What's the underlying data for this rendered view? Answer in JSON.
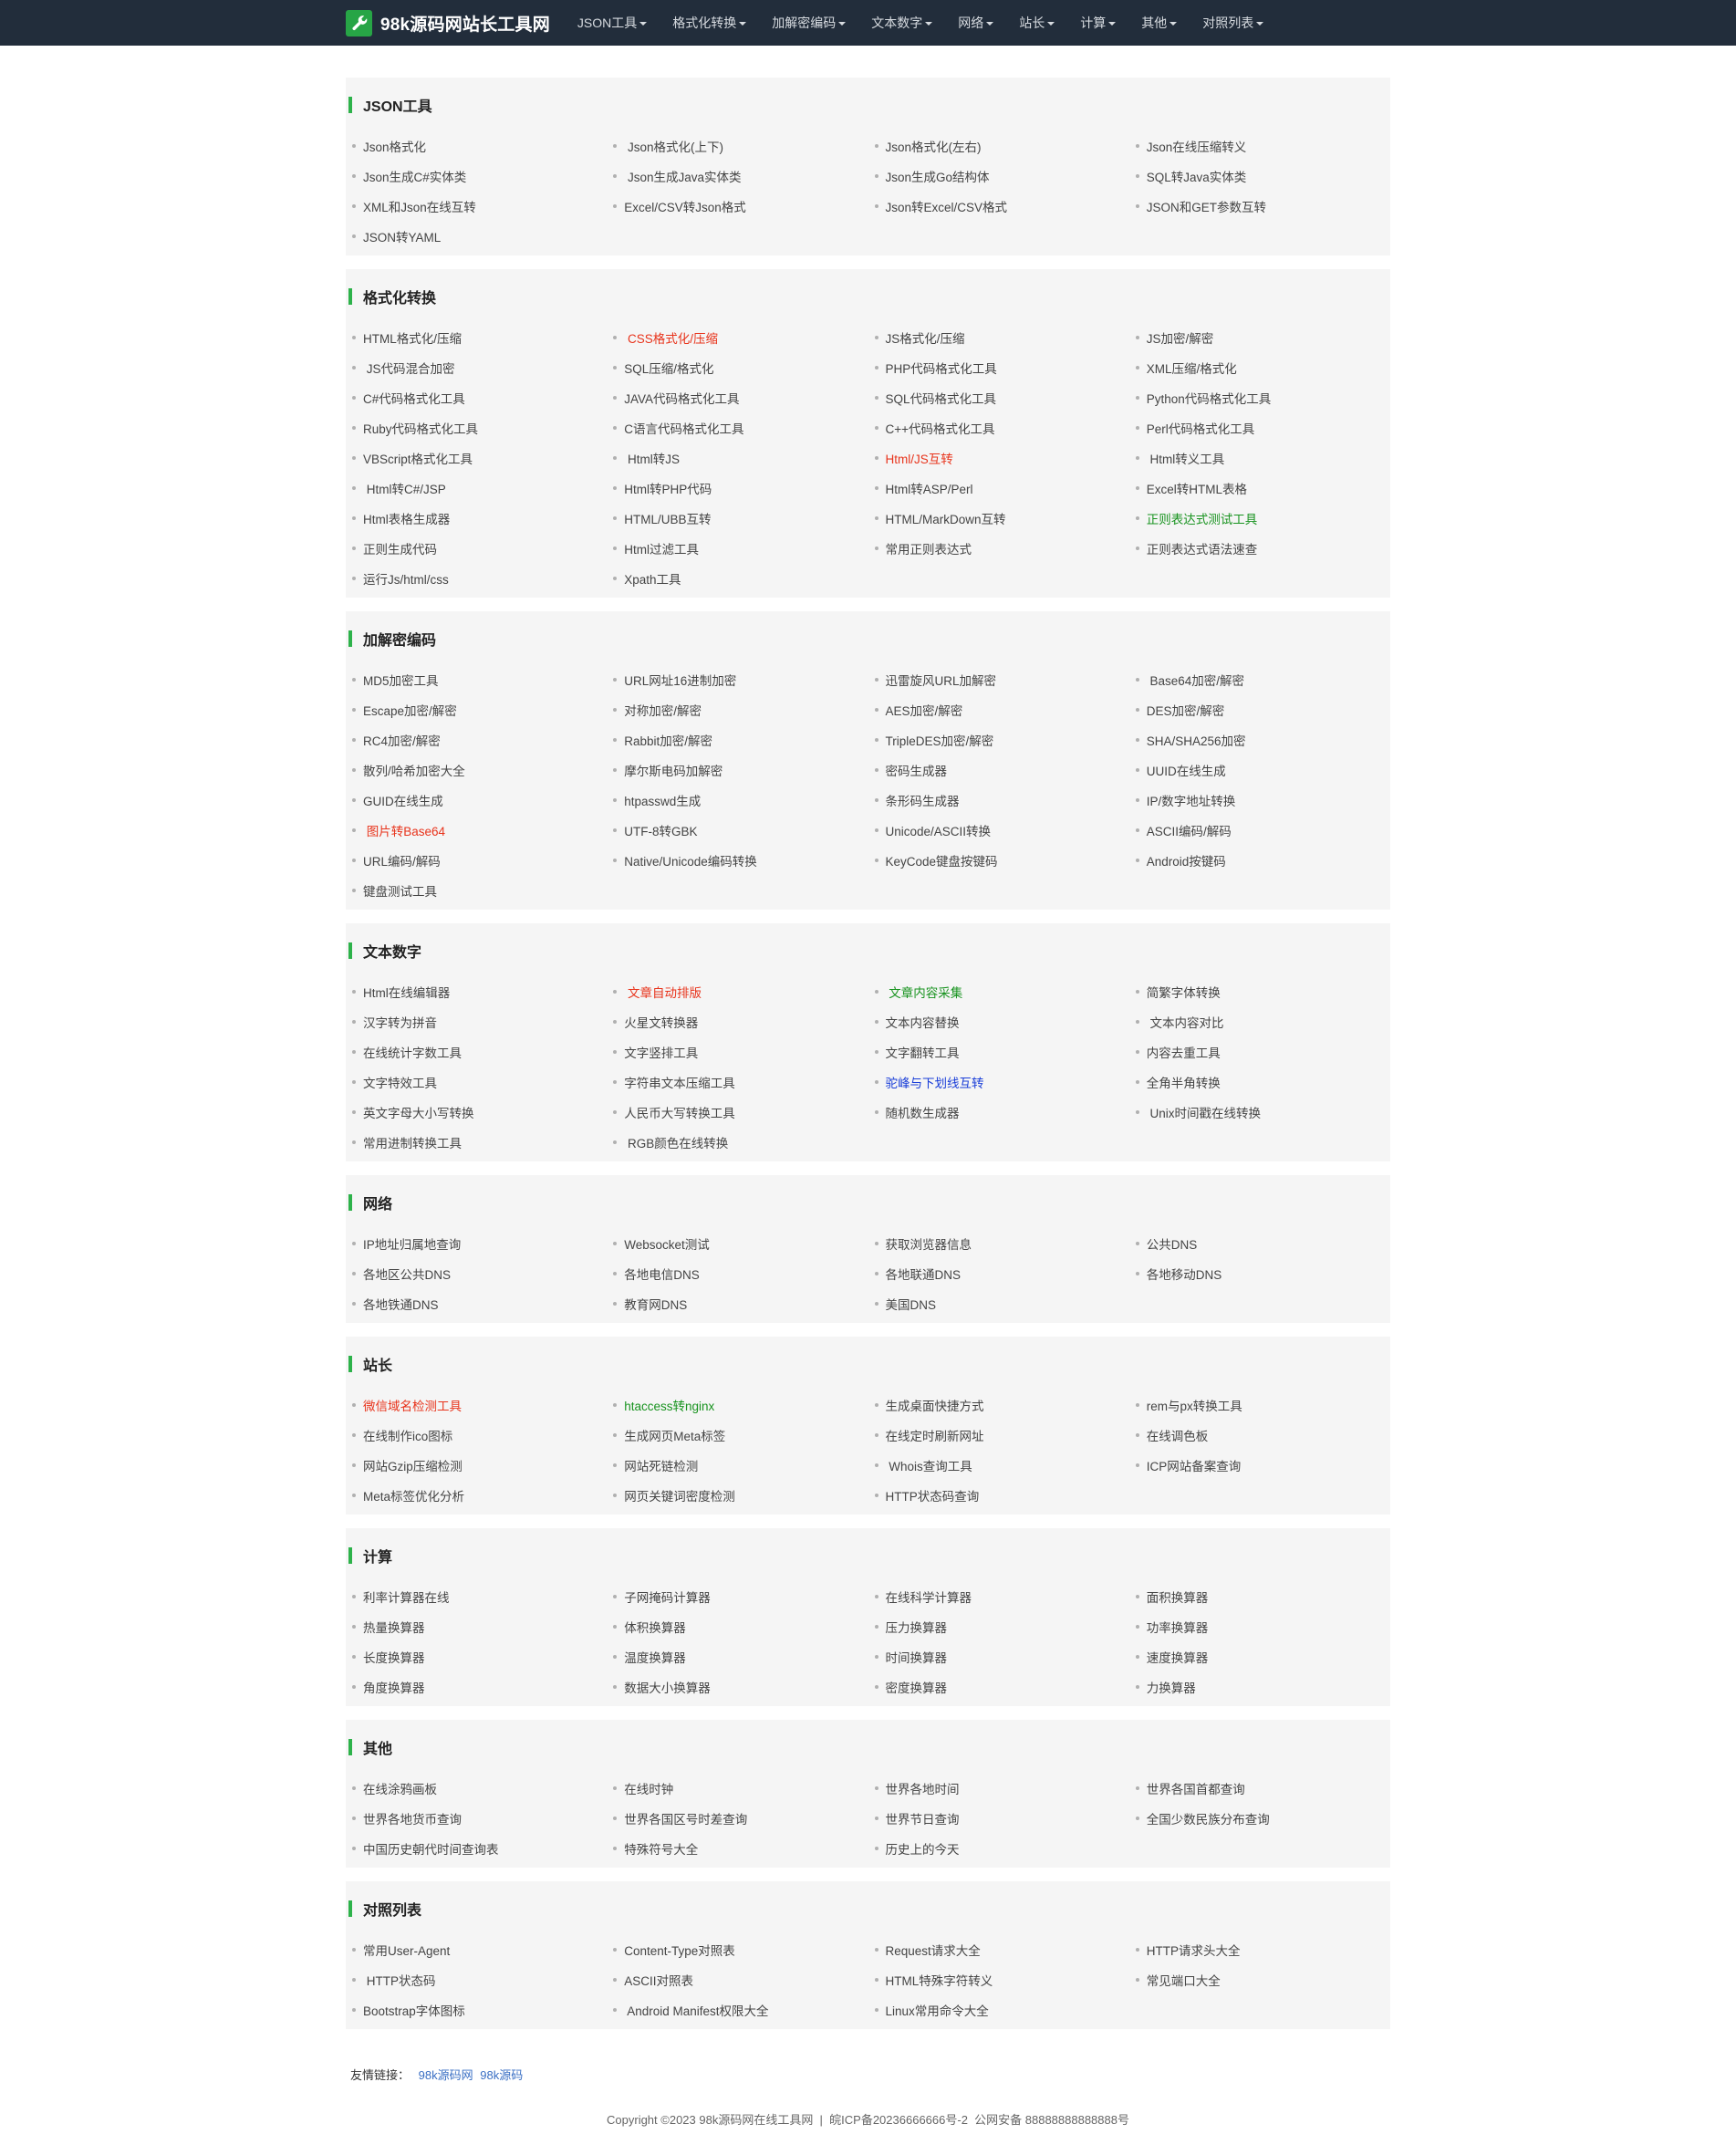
{
  "navbar": {
    "brand": "98k源码网站长工具网",
    "items": [
      "JSON工具",
      "格式化转换",
      "加解密编码",
      "文本数字",
      "网络",
      "站长",
      "计算",
      "其他",
      "对照列表"
    ]
  },
  "sections": [
    {
      "title": "JSON工具",
      "links": [
        {
          "label": "Json格式化"
        },
        {
          "label": " Json格式化(上下)"
        },
        {
          "label": "Json格式化(左右)"
        },
        {
          "label": "Json在线压缩转义"
        },
        {
          "label": "Json生成C#实体类"
        },
        {
          "label": " Json生成Java实体类"
        },
        {
          "label": "Json生成Go结构体"
        },
        {
          "label": "SQL转Java实体类"
        },
        {
          "label": "XML和Json在线互转"
        },
        {
          "label": "Excel/CSV转Json格式"
        },
        {
          "label": "Json转Excel/CSV格式"
        },
        {
          "label": "JSON和GET参数互转"
        },
        {
          "label": "JSON转YAML"
        }
      ]
    },
    {
      "title": "格式化转换",
      "links": [
        {
          "label": "HTML格式化/压缩"
        },
        {
          "label": " CSS格式化/压缩",
          "color": "red"
        },
        {
          "label": "JS格式化/压缩"
        },
        {
          "label": "JS加密/解密"
        },
        {
          "label": " JS代码混合加密"
        },
        {
          "label": "SQL压缩/格式化"
        },
        {
          "label": "PHP代码格式化工具"
        },
        {
          "label": "XML压缩/格式化"
        },
        {
          "label": "C#代码格式化工具"
        },
        {
          "label": "JAVA代码格式化工具"
        },
        {
          "label": "SQL代码格式化工具"
        },
        {
          "label": "Python代码格式化工具"
        },
        {
          "label": "Ruby代码格式化工具"
        },
        {
          "label": "C语言代码格式化工具"
        },
        {
          "label": "C++代码格式化工具"
        },
        {
          "label": "Perl代码格式化工具"
        },
        {
          "label": "VBScript格式化工具"
        },
        {
          "label": " Html转JS"
        },
        {
          "label": "Html/JS互转",
          "color": "red"
        },
        {
          "label": " Html转义工具"
        },
        {
          "label": " Html转C#/JSP"
        },
        {
          "label": "Html转PHP代码"
        },
        {
          "label": "Html转ASP/Perl"
        },
        {
          "label": "Excel转HTML表格"
        },
        {
          "label": "Html表格生成器"
        },
        {
          "label": "HTML/UBB互转"
        },
        {
          "label": "HTML/MarkDown互转"
        },
        {
          "label": "正则表达式测试工具",
          "color": "green"
        },
        {
          "label": "正则生成代码"
        },
        {
          "label": "Html过滤工具"
        },
        {
          "label": "常用正则表达式"
        },
        {
          "label": "正则表达式语法速查"
        },
        {
          "label": "运行Js/html/css"
        },
        {
          "label": "Xpath工具"
        }
      ]
    },
    {
      "title": "加解密编码",
      "links": [
        {
          "label": "MD5加密工具"
        },
        {
          "label": "URL网址16进制加密"
        },
        {
          "label": "迅雷旋风URL加解密"
        },
        {
          "label": " Base64加密/解密"
        },
        {
          "label": "Escape加密/解密"
        },
        {
          "label": "对称加密/解密"
        },
        {
          "label": "AES加密/解密"
        },
        {
          "label": "DES加密/解密"
        },
        {
          "label": "RC4加密/解密"
        },
        {
          "label": "Rabbit加密/解密"
        },
        {
          "label": "TripleDES加密/解密"
        },
        {
          "label": "SHA/SHA256加密"
        },
        {
          "label": "散列/哈希加密大全"
        },
        {
          "label": "摩尔斯电码加解密"
        },
        {
          "label": "密码生成器"
        },
        {
          "label": "UUID在线生成"
        },
        {
          "label": "GUID在线生成"
        },
        {
          "label": "htpasswd生成"
        },
        {
          "label": "条形码生成器"
        },
        {
          "label": "IP/数字地址转换"
        },
        {
          "label": " 图片转Base64",
          "color": "red"
        },
        {
          "label": "UTF-8转GBK"
        },
        {
          "label": "Unicode/ASCII转换"
        },
        {
          "label": "ASCII编码/解码"
        },
        {
          "label": "URL编码/解码"
        },
        {
          "label": "Native/Unicode编码转换"
        },
        {
          "label": "KeyCode键盘按键码"
        },
        {
          "label": "Android按键码"
        },
        {
          "label": "键盘测试工具"
        }
      ]
    },
    {
      "title": "文本数字",
      "links": [
        {
          "label": "Html在线编辑器"
        },
        {
          "label": " 文章自动排版",
          "color": "red"
        },
        {
          "label": " 文章内容采集",
          "color": "green"
        },
        {
          "label": "简繁字体转换"
        },
        {
          "label": "汉字转为拼音"
        },
        {
          "label": "火星文转换器"
        },
        {
          "label": "文本内容替换"
        },
        {
          "label": " 文本内容对比"
        },
        {
          "label": "在线统计字数工具"
        },
        {
          "label": "文字竖排工具"
        },
        {
          "label": "文字翻转工具"
        },
        {
          "label": "内容去重工具"
        },
        {
          "label": "文字特效工具"
        },
        {
          "label": "字符串文本压缩工具"
        },
        {
          "label": "驼峰与下划线互转",
          "color": "blue"
        },
        {
          "label": "全角半角转换"
        },
        {
          "label": "英文字母大小写转换"
        },
        {
          "label": "人民币大写转换工具"
        },
        {
          "label": "随机数生成器"
        },
        {
          "label": " Unix时间戳在线转换"
        },
        {
          "label": "常用进制转换工具"
        },
        {
          "label": " RGB颜色在线转换"
        }
      ]
    },
    {
      "title": "网络",
      "links": [
        {
          "label": "IP地址归属地查询"
        },
        {
          "label": "Websocket测试"
        },
        {
          "label": "获取浏览器信息"
        },
        {
          "label": "公共DNS"
        },
        {
          "label": "各地区公共DNS"
        },
        {
          "label": "各地电信DNS"
        },
        {
          "label": "各地联通DNS"
        },
        {
          "label": "各地移动DNS"
        },
        {
          "label": "各地铁通DNS"
        },
        {
          "label": "教育网DNS"
        },
        {
          "label": "美国DNS"
        }
      ]
    },
    {
      "title": "站长",
      "links": [
        {
          "label": "微信域名检测工具",
          "color": "red"
        },
        {
          "label": "htaccess转nginx",
          "color": "green"
        },
        {
          "label": "生成桌面快捷方式"
        },
        {
          "label": "rem与px转换工具"
        },
        {
          "label": "在线制作ico图标"
        },
        {
          "label": "生成网页Meta标签"
        },
        {
          "label": "在线定时刷新网址"
        },
        {
          "label": "在线调色板"
        },
        {
          "label": "网站Gzip压缩检测"
        },
        {
          "label": "网站死链检测"
        },
        {
          "label": " Whois查询工具"
        },
        {
          "label": "ICP网站备案查询"
        },
        {
          "label": "Meta标签优化分析"
        },
        {
          "label": "网页关键词密度检测"
        },
        {
          "label": "HTTP状态码查询"
        }
      ]
    },
    {
      "title": "计算",
      "links": [
        {
          "label": "利率计算器在线"
        },
        {
          "label": "子网掩码计算器"
        },
        {
          "label": "在线科学计算器"
        },
        {
          "label": "面积换算器"
        },
        {
          "label": "热量换算器"
        },
        {
          "label": "体积换算器"
        },
        {
          "label": "压力换算器"
        },
        {
          "label": "功率换算器"
        },
        {
          "label": "长度换算器"
        },
        {
          "label": "温度换算器"
        },
        {
          "label": "时间换算器"
        },
        {
          "label": "速度换算器"
        },
        {
          "label": "角度换算器"
        },
        {
          "label": "数据大小换算器"
        },
        {
          "label": "密度换算器"
        },
        {
          "label": "力换算器"
        }
      ]
    },
    {
      "title": "其他",
      "links": [
        {
          "label": "在线涂鸦画板"
        },
        {
          "label": "在线时钟"
        },
        {
          "label": "世界各地时间"
        },
        {
          "label": "世界各国首都查询"
        },
        {
          "label": "世界各地货币查询"
        },
        {
          "label": "世界各国区号时差查询"
        },
        {
          "label": "世界节日查询"
        },
        {
          "label": "全国少数民族分布查询"
        },
        {
          "label": "中国历史朝代时间查询表"
        },
        {
          "label": "特殊符号大全"
        },
        {
          "label": "历史上的今天"
        }
      ]
    },
    {
      "title": "对照列表",
      "links": [
        {
          "label": "常用User-Agent"
        },
        {
          "label": "Content-Type对照表"
        },
        {
          "label": "Request请求大全"
        },
        {
          "label": "HTTP请求头大全"
        },
        {
          "label": " HTTP状态码"
        },
        {
          "label": "ASCII对照表"
        },
        {
          "label": "HTML特殊字符转义"
        },
        {
          "label": "常见端口大全"
        },
        {
          "label": "Bootstrap字体图标"
        },
        {
          "label": " Android Manifest权限大全"
        },
        {
          "label": "Linux常用命令大全"
        }
      ]
    }
  ],
  "friends": {
    "label": "友情链接：",
    "links": [
      "98k源码网",
      "98k源码"
    ]
  },
  "footer": {
    "text": "Copyright ©2023 98k源码网在线工具网  |  皖ICP备20236666666号-2  公网安备 88888888888888号"
  },
  "colors": {
    "navbar_bg": "#222d3b",
    "accent_green": "#2db24a",
    "link_red": "#e8341c",
    "link_green": "#18931f",
    "link_blue": "#1a3ed8"
  }
}
